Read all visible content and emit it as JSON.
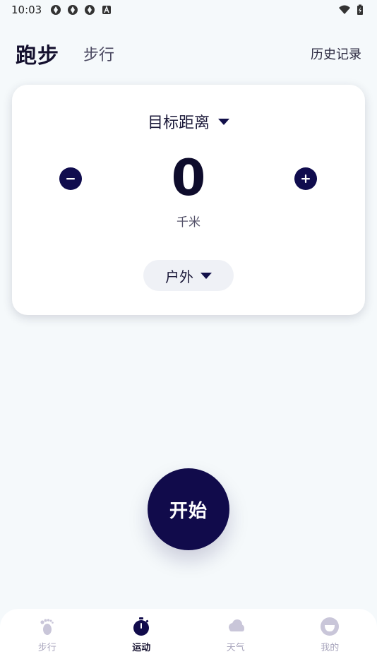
{
  "status_bar": {
    "time": "10:03"
  },
  "header": {
    "tab_run": "跑步",
    "tab_walk": "步行",
    "history": "历史记录"
  },
  "card": {
    "target_label": "目标距离",
    "value": "0",
    "unit": "千米",
    "mode": "户外"
  },
  "start_button": "开始",
  "bottom_nav": {
    "items": [
      {
        "label": "步行",
        "icon": "footprint-icon"
      },
      {
        "label": "运动",
        "icon": "stopwatch-icon",
        "active": true
      },
      {
        "label": "天气",
        "icon": "cloud-icon"
      },
      {
        "label": "我的",
        "icon": "profile-icon"
      }
    ]
  },
  "colors": {
    "accent": "#110b4b",
    "background": "#f5f9fb",
    "nav_inactive": "#a9a6bd"
  }
}
